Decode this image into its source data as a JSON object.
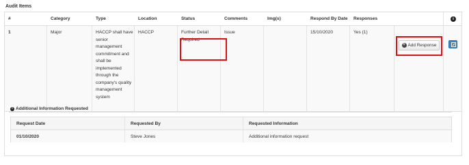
{
  "section_title": "Audit Items",
  "table": {
    "headers": [
      "#",
      "Category",
      "Type",
      "Location",
      "Status",
      "Comments",
      "Img(s)",
      "Respond By Date",
      "Responses"
    ],
    "info_icon": "info-circle-icon",
    "row": {
      "num": "1",
      "category": "Major",
      "type_lines": [
        "HACCP shall have",
        "senior",
        "management",
        "commitment and",
        "shall be",
        "implemented",
        "through the",
        "company's quality",
        "management",
        "system"
      ],
      "location": "HACCP",
      "status_lines": [
        "Further Detail",
        "Required"
      ],
      "comments": "Issue",
      "images": "",
      "respond_by": "15/10/2020",
      "responses": "Yes (1)",
      "add_response_label": "Add Response",
      "add_response_icon": "plus-circle-icon",
      "edit_icon": "edit-icon"
    }
  },
  "additional_info": {
    "title": "Additional Information Requested",
    "icon": "info-circle-icon",
    "headers": [
      "Request Date",
      "Requested By",
      "Requested Information"
    ],
    "rows": [
      [
        "01/10/2020",
        "Steve Jones",
        "Additional information request"
      ]
    ]
  },
  "highlight_color": "#e01010"
}
